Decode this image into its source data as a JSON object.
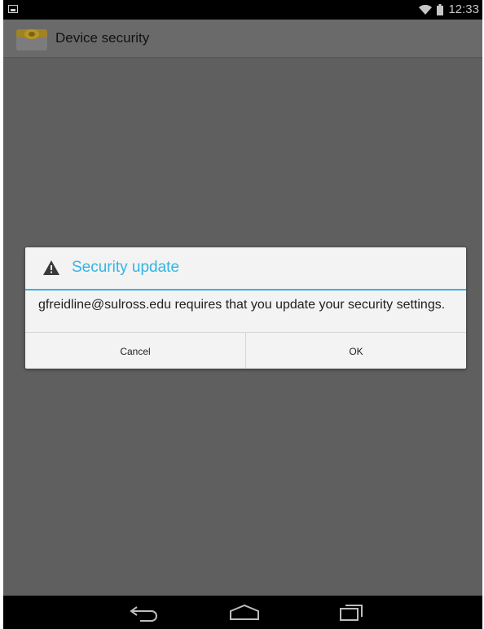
{
  "status_bar": {
    "time": "12:33",
    "icons": [
      "gallery-icon",
      "wifi-icon",
      "battery-icon"
    ]
  },
  "action_bar": {
    "title": "Device security",
    "icon": "email-app-icon"
  },
  "dialog": {
    "icon": "warning-icon",
    "title": "Security update",
    "message": "gfreidline@sulross.edu requires that you update your security settings.",
    "cancel_label": "Cancel",
    "ok_label": "OK"
  },
  "nav_bar": {
    "icons": [
      "back-icon",
      "home-icon",
      "recents-icon"
    ]
  },
  "colors": {
    "accent": "#33b5e5",
    "scrim_background": "#5f5f5f",
    "dialog_background": "#f3f3f3"
  }
}
